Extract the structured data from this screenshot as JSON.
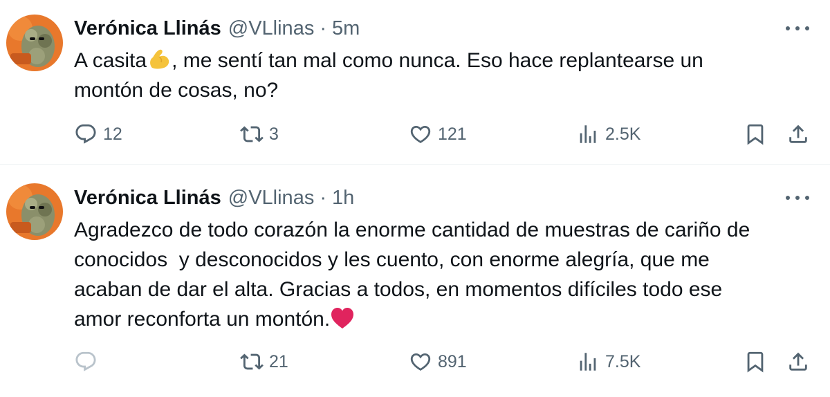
{
  "tweets": [
    {
      "author_name": "Verónica Llinás",
      "handle": "@VLlinas",
      "separator": "·",
      "time": "5m",
      "text_before_emoji": "A casita",
      "emoji": "flexed-biceps",
      "text_after_emoji": ", me sentí tan mal como nunca. Eso hace replantearse un\nmontón de cosas, no?",
      "replies": "12",
      "retweets": "3",
      "likes": "121",
      "views": "2.5K"
    },
    {
      "author_name": "Verónica Llinás",
      "handle": "@VLlinas",
      "separator": "·",
      "time": "1h",
      "text_before_emoji": "Agradezco de todo corazón la enorme cantidad de muestras de cariño de\nconocidos  y desconocidos y les cuento, con enorme alegría, que me\nacaban de dar el alta. Gracias a todos, en momentos difíciles todo ese\namor reconforta un montón.",
      "emoji": "red-heart",
      "text_after_emoji": "",
      "replies": "",
      "retweets": "21",
      "likes": "891",
      "views": "7.5K"
    }
  ],
  "colors": {
    "text": "#0f1419",
    "secondary": "#536471",
    "divider": "#eff3f4",
    "heart": "#e0245e",
    "biceps": "#f5c33b"
  }
}
